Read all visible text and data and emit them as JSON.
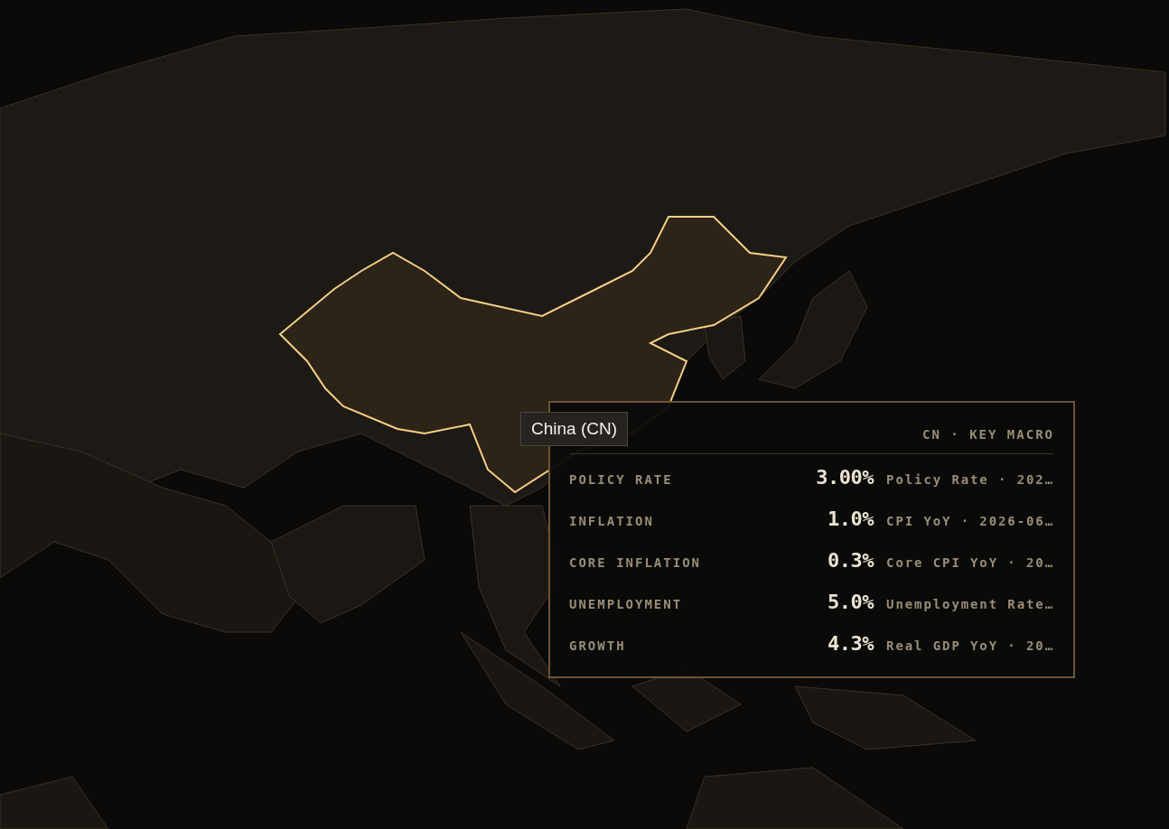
{
  "hover_label": "China (CN)",
  "tooltip": {
    "header": "CN · KEY MACRO",
    "rows": [
      {
        "label": "POLICY RATE",
        "value": "3.00%",
        "source": "Policy Rate · 202…"
      },
      {
        "label": "INFLATION",
        "value": "1.0%",
        "source": "CPI YoY · 2026-06…"
      },
      {
        "label": "CORE INFLATION",
        "value": "0.3%",
        "source": "Core CPI YoY · 20…"
      },
      {
        "label": "UNEMPLOYMENT",
        "value": "5.0%",
        "source": "Unemployment Rate…"
      },
      {
        "label": "GROWTH",
        "value": "4.3%",
        "source": "Real GDP YoY · 20…"
      }
    ]
  }
}
